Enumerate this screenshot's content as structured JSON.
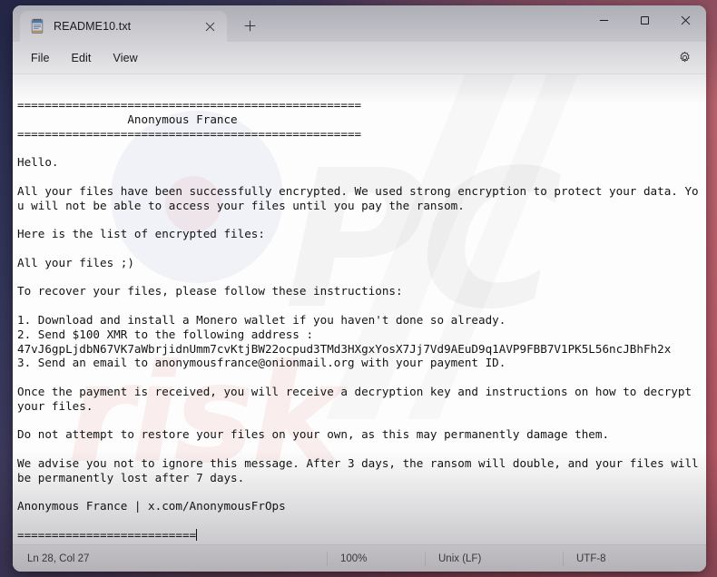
{
  "window": {
    "tab": {
      "icon": "notepad-icon",
      "title": "README10.txt",
      "close_label": "×"
    },
    "new_tab_label": "+",
    "controls": {
      "minimize": "—",
      "maximize": "□",
      "close": "✕"
    }
  },
  "menubar": {
    "items": [
      {
        "label": "File"
      },
      {
        "label": "Edit"
      },
      {
        "label": "View"
      }
    ],
    "settings_icon": "gear-icon"
  },
  "editor": {
    "content": "==================================================\n                Anonymous France\n==================================================\n\nHello.\n\nAll your files have been successfully encrypted. We used strong encryption to protect your data. You will not be able to access your files until you pay the ransom.\n\nHere is the list of encrypted files:\n\nAll your files ;)\n\nTo recover your files, please follow these instructions:\n\n1. Download and install a Monero wallet if you haven't done so already.\n2. Send $100 XMR to the following address :\n47vJ6gpLjdbN67VK7aWbrjidnUmm7cvKtjBW22ocpud3TMd3HXgxYosX7Jj7Vd9AEuD9q1AVP9FBB7V1PK5L56ncJBhFh2x\n3. Send an email to anonymousfrance@onionmail.org with your payment ID.\n\nOnce the payment is received, you will receive a decryption key and instructions on how to decrypt your files.\n\nDo not attempt to restore your files on your own, as this may permanently damage them.\n\nWe advise you not to ignore this message. After 3 days, the ransom will double, and your files will be permanently lost after 7 days.\n\nAnonymous France | x.com/AnonymousFrOps\n\n==========================",
    "monero_address": "47vJ6gpLjdbN67VK7aWbrjidnUmm7cvKtjBW22ocpud3TMd3HXgxYosX7Jj7Vd9AEuD9q1AVP9FBB7V1PK5L56ncJBhFh2x",
    "contact_email": "anonymousfrance@onionmail.org",
    "social_link": "x.com/AnonymousFrOps",
    "title_banner": "Anonymous France",
    "ransom_amount": "$100 XMR"
  },
  "watermark": {
    "primary": "PC",
    "secondary": "risk"
  },
  "statusbar": {
    "position": "Ln 28, Col 27",
    "zoom": "100%",
    "line_ending": "Unix (LF)",
    "encoding": "UTF-8"
  },
  "colors": {
    "accent": "#0078d4",
    "close_hover": "#e81123",
    "window_bg": "#fdfdfd",
    "titlebar_bg": "#ececed"
  }
}
